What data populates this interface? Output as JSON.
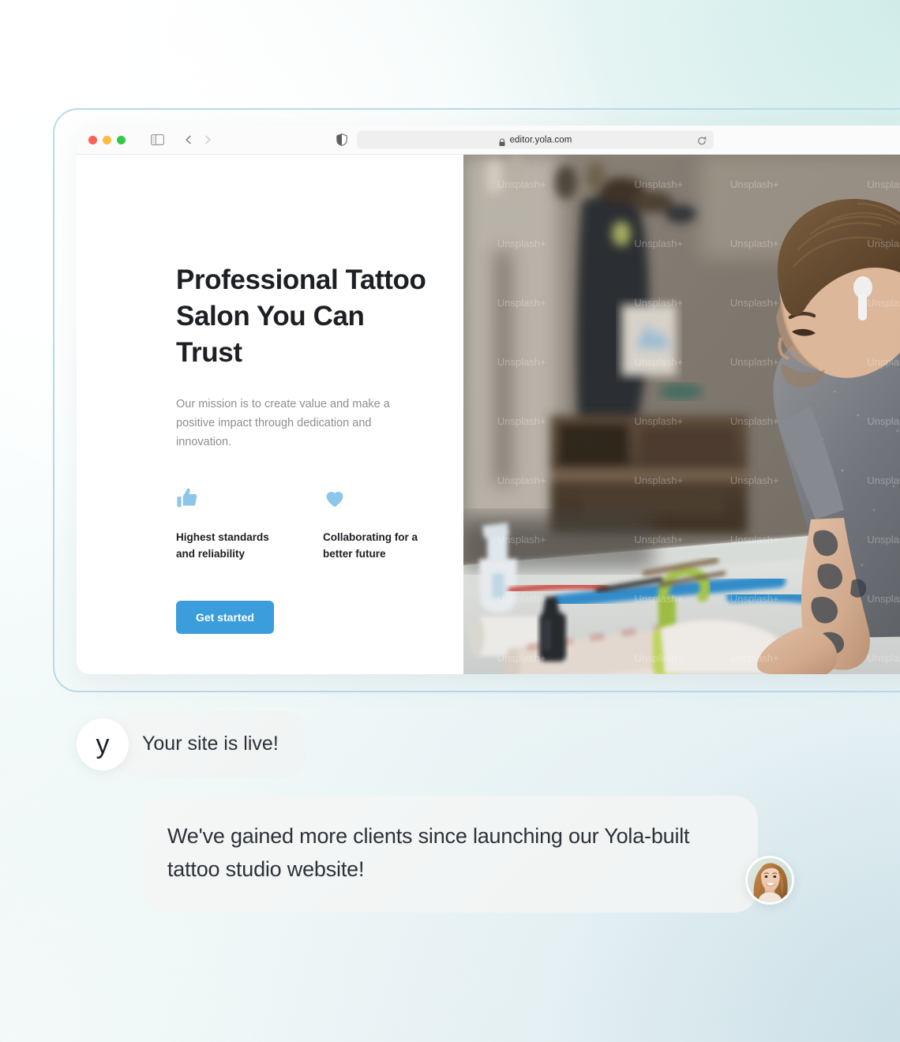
{
  "browser": {
    "url": "editor.yola.com",
    "icons": {
      "sidebar": "sidebar-toggle-icon",
      "back": "back-chevron-icon",
      "forward": "forward-chevron-icon",
      "shield": "privacy-shield-icon",
      "lock": "lock-icon",
      "reload": "reload-icon"
    },
    "traffic_lights": [
      "close-red",
      "minimize-yellow",
      "maximize-green"
    ],
    "colors": {
      "red": "#fc6058",
      "yellow": "#fdbc40",
      "green": "#34c749"
    }
  },
  "site": {
    "headline": "Professional Tattoo Salon You Can Trust",
    "subtext": "Our mission is to create value and make a positive impact through dedication and innovation.",
    "features": [
      {
        "icon": "thumbs-up-icon",
        "label": "Highest standards and reliability"
      },
      {
        "icon": "heart-icon",
        "label": "Collaborating for a better future"
      }
    ],
    "cta_label": "Get started",
    "accent_color": "#3c9ddd",
    "feature_icon_color": "#8cc6ea",
    "photo_watermark": "Unsplash+"
  },
  "chat": {
    "messages": [
      {
        "avatar": "yola-logo-avatar",
        "avatar_glyph": "y",
        "text": "Your site is live!"
      },
      {
        "avatar": "customer-photo-avatar",
        "text": "We've gained more clients since launching our Yola-built tattoo studio website!"
      }
    ]
  }
}
